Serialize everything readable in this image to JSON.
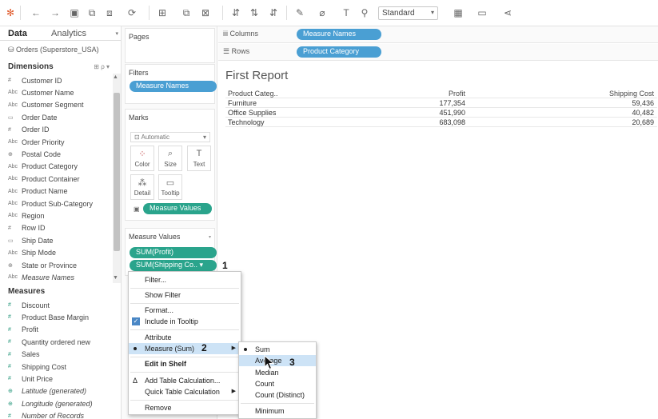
{
  "toolbar": {
    "style_select": "Standard"
  },
  "data_pane": {
    "tabs": [
      "Data",
      "Analytics"
    ],
    "datasource": "Orders (Superstore_USA)",
    "dimensions_header": "Dimensions",
    "dimensions": [
      {
        "type": "#",
        "name": "Customer ID"
      },
      {
        "type": "Abc",
        "name": "Customer Name"
      },
      {
        "type": "Abc",
        "name": "Customer Segment"
      },
      {
        "type": "date",
        "name": "Order Date"
      },
      {
        "type": "#",
        "name": "Order ID"
      },
      {
        "type": "Abc",
        "name": "Order Priority"
      },
      {
        "type": "geo",
        "name": "Postal Code"
      },
      {
        "type": "Abc",
        "name": "Product Category"
      },
      {
        "type": "Abc",
        "name": "Product Container"
      },
      {
        "type": "Abc",
        "name": "Product Name"
      },
      {
        "type": "Abc",
        "name": "Product Sub-Category"
      },
      {
        "type": "Abc",
        "name": "Region"
      },
      {
        "type": "#",
        "name": "Row ID"
      },
      {
        "type": "date",
        "name": "Ship Date"
      },
      {
        "type": "Abc",
        "name": "Ship Mode"
      },
      {
        "type": "geo",
        "name": "State or Province"
      },
      {
        "type": "Abc",
        "name": "Measure Names"
      }
    ],
    "measures_header": "Measures",
    "measures": [
      {
        "type": "#",
        "name": "Discount"
      },
      {
        "type": "#",
        "name": "Product Base Margin"
      },
      {
        "type": "#",
        "name": "Profit"
      },
      {
        "type": "#",
        "name": "Quantity ordered new"
      },
      {
        "type": "#",
        "name": "Sales"
      },
      {
        "type": "#",
        "name": "Shipping Cost"
      },
      {
        "type": "#",
        "name": "Unit Price"
      },
      {
        "type": "geo",
        "name": "Latitude (generated)"
      },
      {
        "type": "geo",
        "name": "Longitude (generated)"
      },
      {
        "type": "#",
        "name": "Number of Records"
      }
    ]
  },
  "cards": {
    "pages": "Pages",
    "filters": "Filters",
    "filter_pill": "Measure Names",
    "marks": "Marks",
    "marks_type": "Automatic",
    "mark_buttons": [
      "Color",
      "Size",
      "Text",
      "Detail",
      "Tooltip"
    ],
    "marks_pill": "Measure Values",
    "measure_values": "Measure Values",
    "mv_pills": [
      "SUM(Profit)",
      "SUM(Shipping Co..  ▾"
    ]
  },
  "shelves": {
    "columns_label": "Columns",
    "columns_pill": "Measure Names",
    "rows_label": "Rows",
    "rows_pill": "Product Category"
  },
  "view": {
    "title": "First Report",
    "headers": [
      "Product Categ..",
      "Profit",
      "Shipping Cost"
    ],
    "rows": [
      [
        "Furniture",
        "177,354",
        "59,436"
      ],
      [
        "Office Supplies",
        "451,990",
        "40,482"
      ],
      [
        "Technology",
        "683,098",
        "20,689"
      ]
    ]
  },
  "context_menu": {
    "items": [
      "Filter...",
      "Show Filter",
      "Format...",
      "Include in Tooltip",
      "Attribute",
      "Measure (Sum)",
      "Edit in Shelf",
      "Add Table Calculation...",
      "Quick Table Calculation",
      "Remove"
    ]
  },
  "submenu": {
    "items": [
      "Sum",
      "Average",
      "Median",
      "Count",
      "Count (Distinct)",
      "Minimum"
    ]
  },
  "annotations": [
    "1",
    "2",
    "3"
  ],
  "colors": {
    "pill_green": "#2aa48c",
    "pill_blue": "#4a9fd3",
    "highlight": "#cde3f6"
  }
}
